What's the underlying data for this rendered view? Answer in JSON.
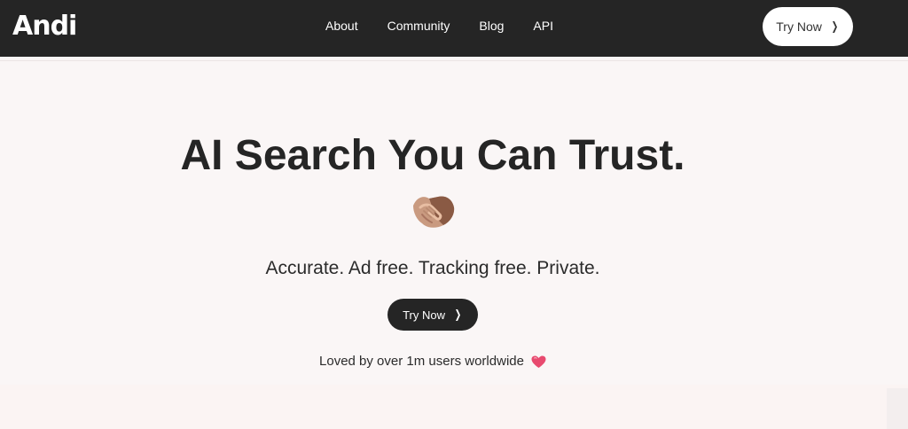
{
  "header": {
    "logo": "Andi",
    "nav": [
      {
        "label": "About"
      },
      {
        "label": "Community"
      },
      {
        "label": "Blog"
      },
      {
        "label": "API"
      }
    ],
    "cta_label": "Try Now"
  },
  "hero": {
    "title": "AI Search You Can Trust.",
    "emoji_icon": "handshake-icon",
    "subtitle": "Accurate.  Ad free. Tracking free.  Private.",
    "cta_label": "Try Now",
    "loved_text": "Loved by over 1m users worldwide",
    "loved_icon": "heart-icon"
  },
  "colors": {
    "nav_bg": "#252525",
    "page_bg": "#faf6f6",
    "button_dark": "#252525",
    "heart": "#e84a6f"
  }
}
